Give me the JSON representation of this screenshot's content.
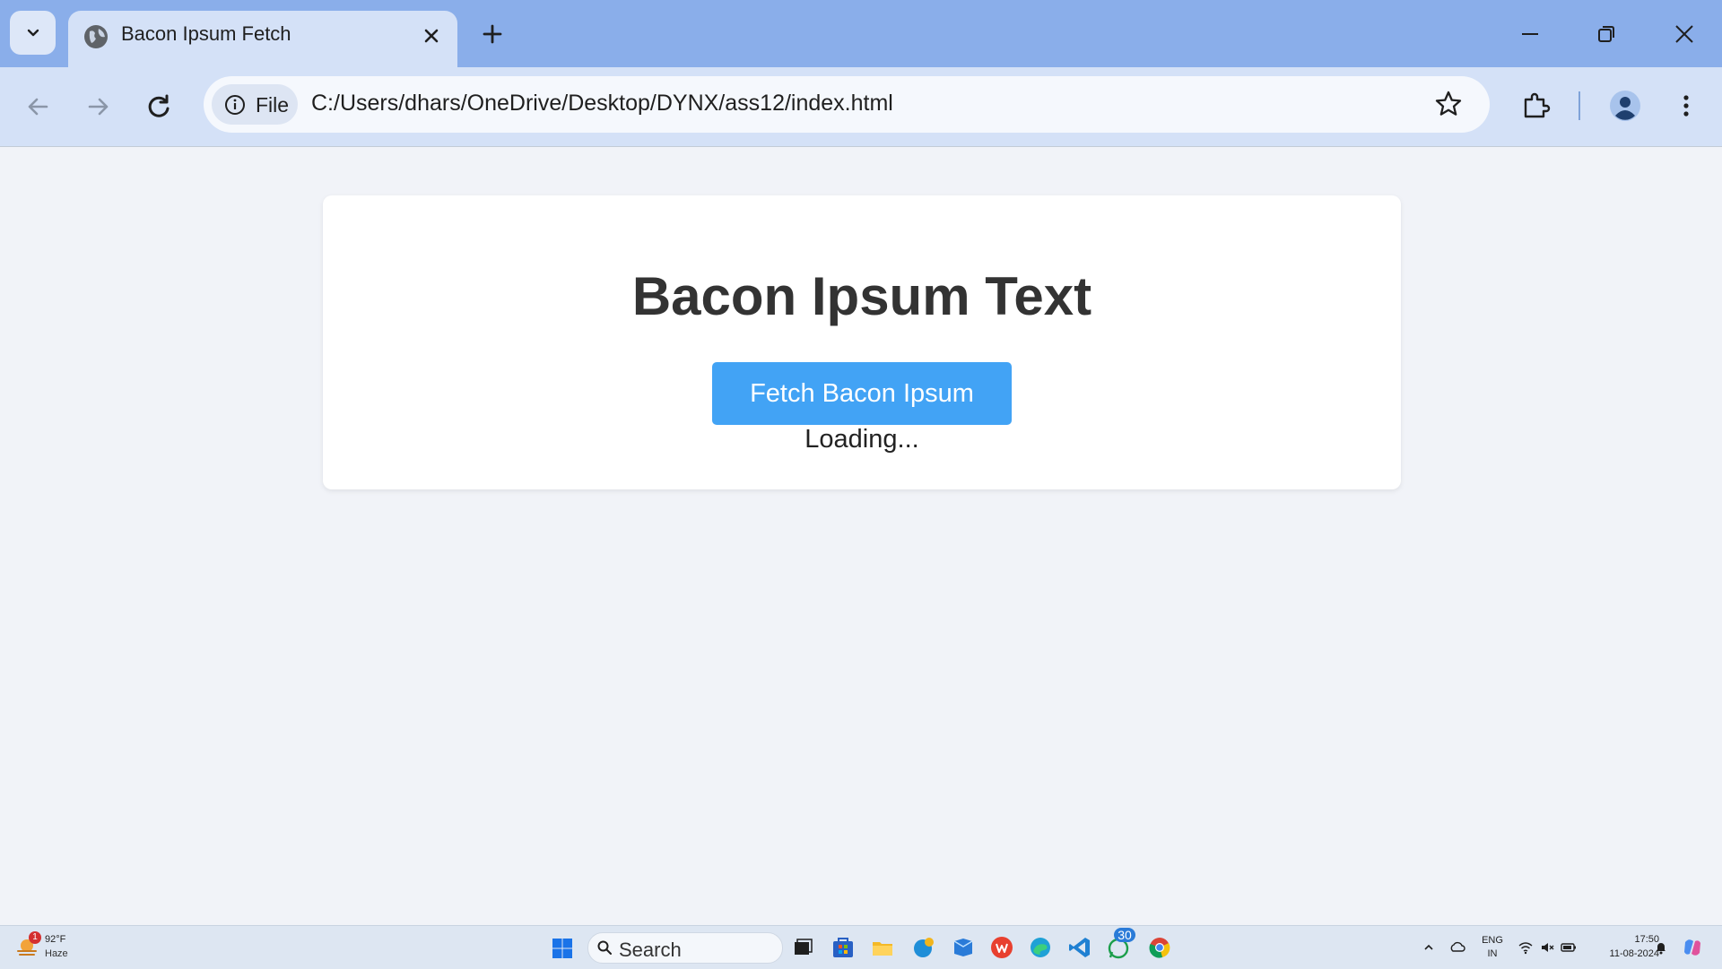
{
  "browser": {
    "tab_title": "Bacon Ipsum Fetch",
    "address_chip": "File",
    "url": "C:/Users/dhars/OneDrive/Desktop/DYNX/ass12/index.html",
    "accent_color": "#8aaeea"
  },
  "page": {
    "heading": "Bacon Ipsum Text",
    "button_label": "Fetch Bacon Ipsum",
    "status_text": "Loading...",
    "button_color": "#42a3f5"
  },
  "taskbar": {
    "weather_temp": "92°F",
    "weather_desc": "Haze",
    "weather_badge": "1",
    "search_label": "Search",
    "whatsapp_badge": "30",
    "language": "ENG",
    "region": "IN",
    "time": "17:50",
    "date": "11-08-2024"
  }
}
